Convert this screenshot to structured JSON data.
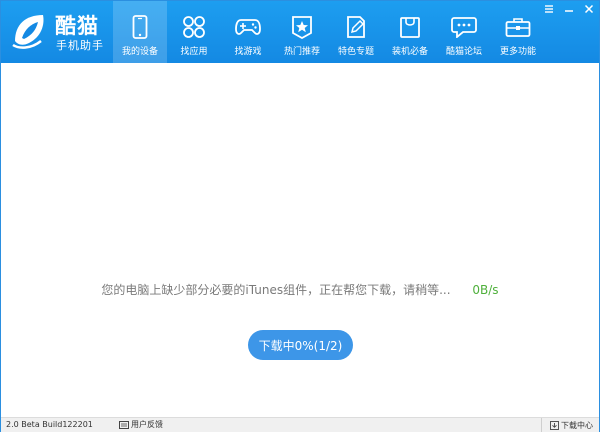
{
  "app": {
    "name": "酷猫",
    "subtitle": "手机助手",
    "brand_color": "#1489e3"
  },
  "nav": {
    "items": [
      {
        "label": "我的设备",
        "icon": "phone-icon",
        "active": true
      },
      {
        "label": "找应用",
        "icon": "apps-grid-icon",
        "active": false
      },
      {
        "label": "找游戏",
        "icon": "gamepad-icon",
        "active": false
      },
      {
        "label": "热门推荐",
        "icon": "star-badge-icon",
        "active": false
      },
      {
        "label": "特色专题",
        "icon": "edit-icon",
        "active": false
      },
      {
        "label": "装机必备",
        "icon": "shopping-bag-icon",
        "active": false
      },
      {
        "label": "酷猫论坛",
        "icon": "chat-bubble-icon",
        "active": false
      },
      {
        "label": "更多功能",
        "icon": "toolbox-icon",
        "active": false
      }
    ]
  },
  "window_controls": [
    "menu-icon",
    "minimize-icon",
    "close-icon"
  ],
  "main": {
    "message": "您的电脑上缺少部分必要的iTunes组件，正在帮您下载，请稍等...",
    "speed": "0B/s",
    "speed_color": "#4fb03c",
    "button_label": "下载中0%(1/2)"
  },
  "statusbar": {
    "version": "2.0 Beta Build122201",
    "feedback": "用户反馈",
    "download_center": "下载中心"
  }
}
